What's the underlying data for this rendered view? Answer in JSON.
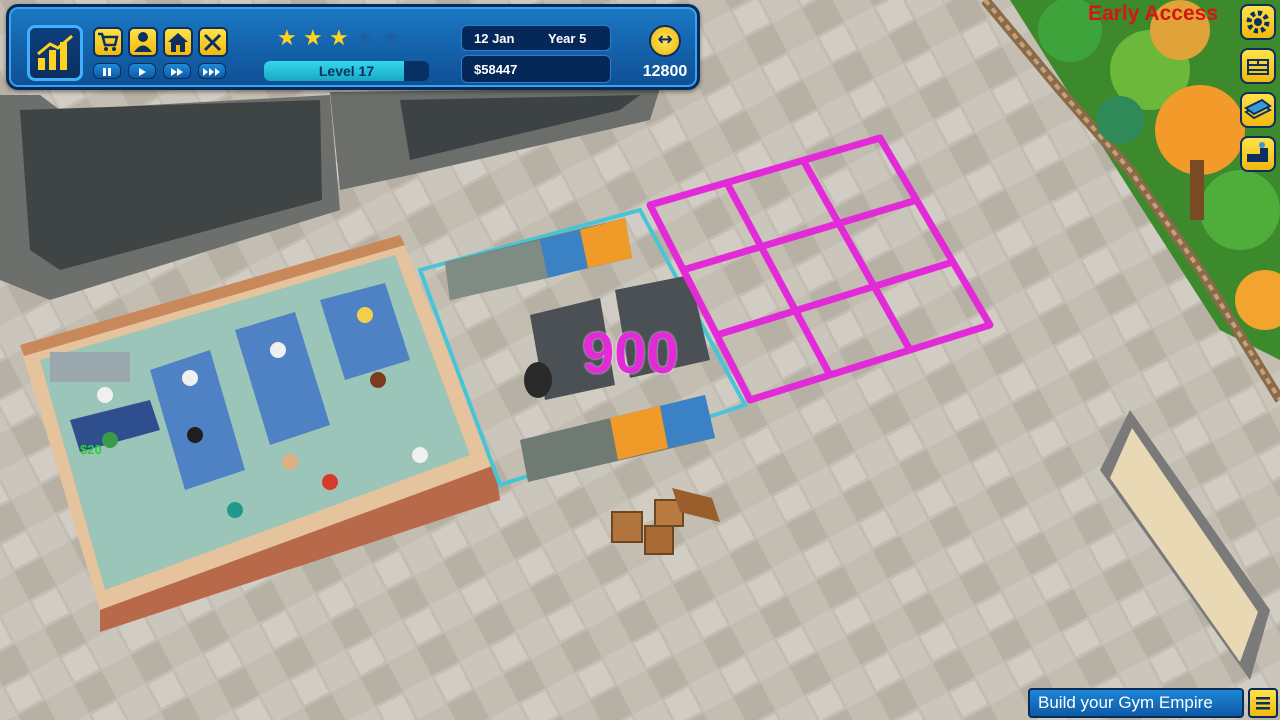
{
  "hud": {
    "date": "12 Jan",
    "year": "Year 5",
    "level": "Level 17",
    "level_progress": 0.85,
    "money": "$58447",
    "rating_stars": 3,
    "rating_max": 5,
    "energy": "12800"
  },
  "toolbar_icons": [
    "shop-cart-icon",
    "staff-person-icon",
    "home-icon",
    "build-tools-icon"
  ],
  "speed_controls": [
    "pause-icon",
    "play-icon",
    "fast-forward-icon",
    "fastest-forward-icon"
  ],
  "side_icons": [
    "settings-gear-icon",
    "wall-build-icon",
    "floor-tiles-icon",
    "equipment-icon"
  ],
  "early_access": "Early Access",
  "placement_price": "900",
  "floating_money": "$20",
  "banner": "Build your Gym Empire",
  "colors": {
    "hud_blue": "#1b78c4",
    "button_yellow": "#f2b90c",
    "placement_magenta": "#e22ad8",
    "early_access_red": "#d81414",
    "money_green": "#2fcf2f"
  }
}
